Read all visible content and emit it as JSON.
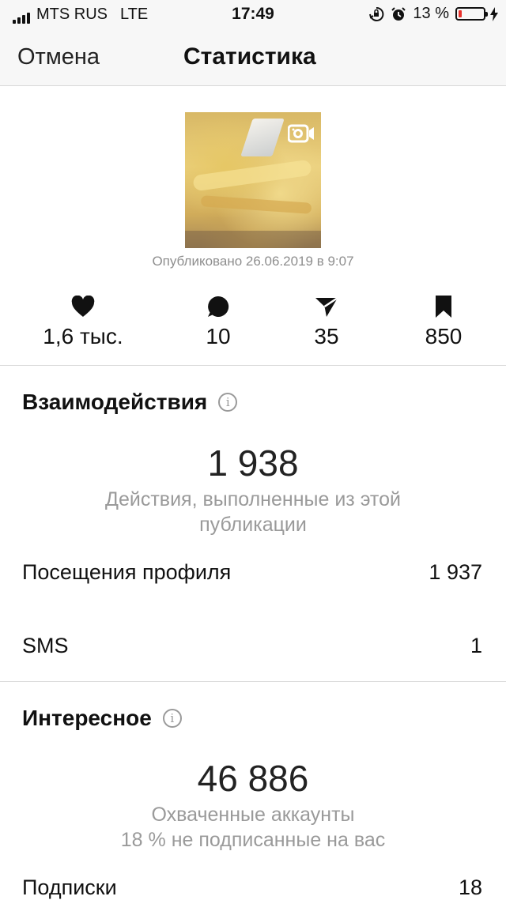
{
  "status_bar": {
    "carrier": "MTS RUS",
    "network": "LTE",
    "time": "17:49",
    "battery_percent": "13 %",
    "battery_level": 0.13,
    "icons": [
      "signal-icon",
      "orientation-lock-icon",
      "alarm-icon",
      "battery-icon",
      "charging-bolt-icon"
    ]
  },
  "nav": {
    "cancel_label": "Отмена",
    "title": "Статистика"
  },
  "post": {
    "published": "Опубликовано 26.06.2019 в 9:07",
    "media_icon": "video-icon"
  },
  "stats": [
    {
      "icon": "heart-icon",
      "value": "1,6 тыс."
    },
    {
      "icon": "comment-icon",
      "value": "10"
    },
    {
      "icon": "share-icon",
      "value": "35"
    },
    {
      "icon": "bookmark-icon",
      "value": "850"
    }
  ],
  "interactions": {
    "title": "Взаимодействия",
    "total": "1 938",
    "caption_line1": "Действия, выполненные из этой",
    "caption_line2": "публикации",
    "rows": [
      {
        "label": "Посещения профиля",
        "value": "1 937"
      },
      {
        "label": "SMS",
        "value": "1"
      }
    ]
  },
  "discovery": {
    "title": "Интересное",
    "total": "46 886",
    "caption_line1": "Охваченные аккаунты",
    "caption_line2": "18 % не подписанные на вас",
    "rows": [
      {
        "label": "Подписки",
        "value": "18"
      }
    ]
  },
  "colors": {
    "battery_low": "#e8322c",
    "muted_text": "#9a9a9a",
    "bar_background": "#f7f7f7"
  }
}
